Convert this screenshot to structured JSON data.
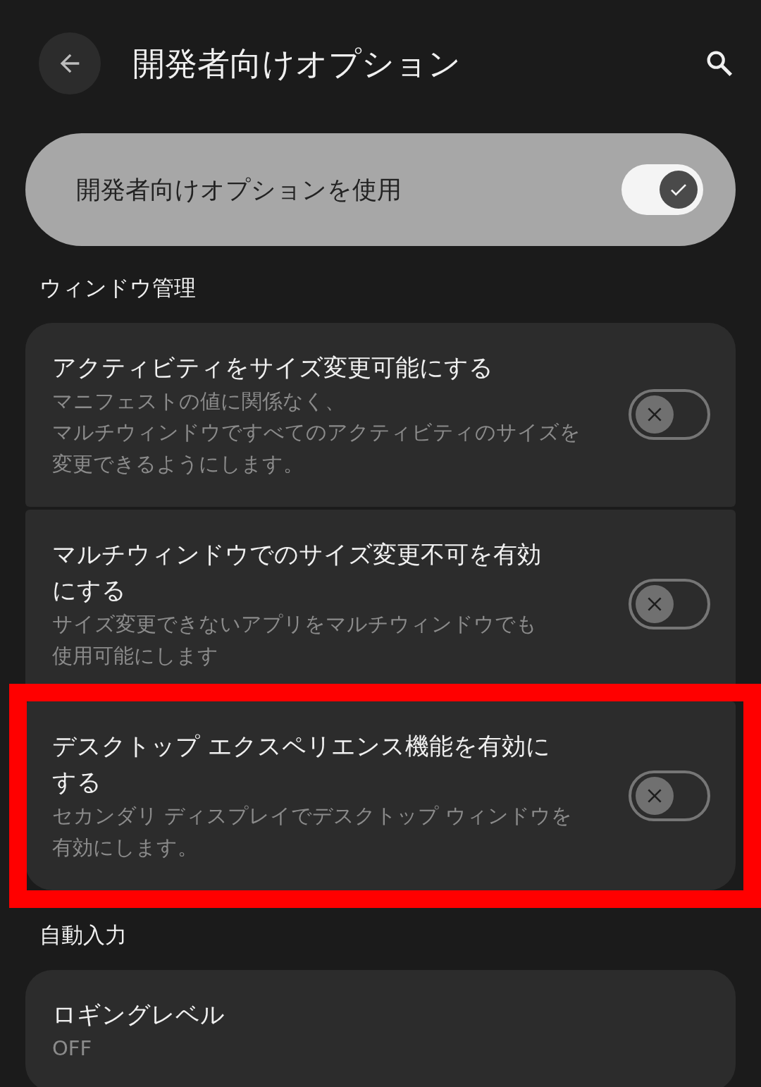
{
  "app_bar": {
    "title": "開発者向けオプション"
  },
  "main_switch": {
    "label": "開発者向けオプションを使用",
    "on": true
  },
  "sections": [
    {
      "header": "ウィンドウ管理",
      "items": [
        {
          "kind": "switch",
          "title": "アクティビティをサイズ変更可能にする",
          "summary_lines": [
            "マニフェストの値に関係なく、",
            "マルチウィンドウですべてのアクティビティのサイズを",
            "変更できるようにします。"
          ],
          "on": false,
          "highlighted": false
        },
        {
          "kind": "switch",
          "title": "マルチウィンドウでのサイズ変更不可を有効にする",
          "summary_lines": [
            "サイズ変更できないアプリをマルチウィンドウでも",
            "使用可能にします"
          ],
          "on": false,
          "highlighted": false
        },
        {
          "kind": "switch",
          "title": "デスクトップ エクスペリエンス機能を有効にする",
          "summary_lines": [
            "セカンダリ ディスプレイでデスクトップ ウィンドウを",
            "有効にします。"
          ],
          "on": false,
          "highlighted": true
        }
      ]
    },
    {
      "header": "自動入力",
      "items": [
        {
          "kind": "value",
          "title": "ロギングレベル",
          "summary_lines": [
            "OFF"
          ]
        }
      ]
    }
  ]
}
